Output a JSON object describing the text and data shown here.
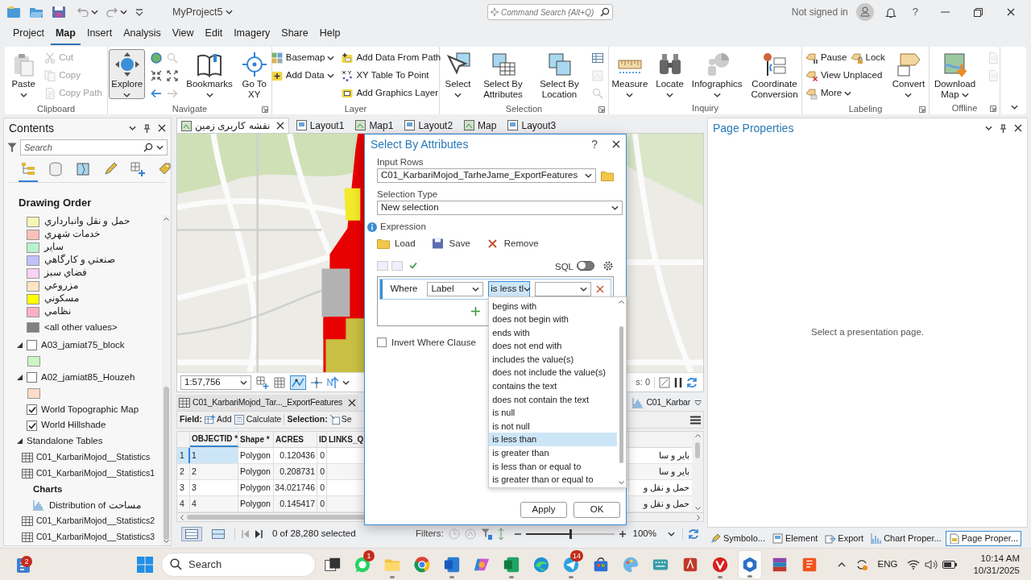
{
  "title_bar": {
    "project": "MyProject5",
    "command_search": {
      "placeholder": "Command Search (Alt+Q)"
    },
    "account": "Not signed in",
    "help": "?"
  },
  "menu_tabs": [
    {
      "label": "Project",
      "selected": false
    },
    {
      "label": "Map",
      "selected": true
    },
    {
      "label": "Insert",
      "selected": false
    },
    {
      "label": "Analysis",
      "selected": false
    },
    {
      "label": "View",
      "selected": false
    },
    {
      "label": "Edit",
      "selected": false
    },
    {
      "label": "Imagery",
      "selected": false
    },
    {
      "label": "Share",
      "selected": false
    },
    {
      "label": "Help",
      "selected": false
    }
  ],
  "ribbon": {
    "groups": [
      {
        "name": "Clipboard",
        "launcher": false,
        "items": [
          {
            "kind": "large",
            "label": "Paste",
            "dropdown": true,
            "disabled": false,
            "selected": false
          },
          {
            "kind": "stack",
            "rows": [
              [
                {
                  "kind": "small",
                  "label": "Cut",
                  "dropdown": false,
                  "disabled": true
                }
              ],
              [
                {
                  "kind": "small",
                  "label": "Copy",
                  "dropdown": false,
                  "disabled": true
                }
              ],
              [
                {
                  "kind": "small",
                  "label": "Copy Path",
                  "dropdown": false,
                  "disabled": true
                }
              ]
            ]
          }
        ]
      },
      {
        "name": "Navigate",
        "launcher": true,
        "items": [
          {
            "kind": "large",
            "label": "Explore",
            "dropdown": true,
            "disabled": false,
            "selected": true
          },
          {
            "kind": "stack",
            "rows": [
              [
                {
                  "kind": "icon",
                  "disabled": false
                },
                {
                  "kind": "icon",
                  "disabled": true
                }
              ],
              [
                {
                  "kind": "icon",
                  "disabled": false
                },
                {
                  "kind": "icon",
                  "disabled": false
                }
              ],
              [
                {
                  "kind": "icon",
                  "disabled": false
                },
                {
                  "kind": "icon",
                  "disabled": true
                }
              ]
            ]
          },
          {
            "kind": "large",
            "label": "Bookmarks",
            "dropdown": true,
            "disabled": false,
            "selected": false
          },
          {
            "kind": "large",
            "label": "Go To XY",
            "dropdown": false,
            "disabled": false,
            "selected": false
          }
        ]
      },
      {
        "name": "Layer",
        "launcher": false,
        "items": [
          {
            "kind": "stack",
            "rows": [
              [
                {
                  "kind": "small",
                  "label": "Basemap",
                  "dropdown": true,
                  "disabled": false
                }
              ],
              [
                {
                  "kind": "small",
                  "label": "Add Data",
                  "dropdown": true,
                  "disabled": false
                }
              ]
            ]
          },
          {
            "kind": "stack",
            "rows": [
              [
                {
                  "kind": "small",
                  "label": "Add Data From Path",
                  "dropdown": false,
                  "disabled": false
                }
              ],
              [
                {
                  "kind": "small",
                  "label": "XY Table To Point",
                  "dropdown": false,
                  "disabled": false
                }
              ],
              [
                {
                  "kind": "small",
                  "label": "Add Graphics Layer",
                  "dropdown": false,
                  "disabled": false
                }
              ]
            ]
          }
        ]
      },
      {
        "name": "Selection",
        "launcher": true,
        "items": [
          {
            "kind": "large",
            "label": "Select",
            "dropdown": true,
            "disabled": false,
            "selected": false
          },
          {
            "kind": "large",
            "label": "Select By Attributes",
            "dropdown": false,
            "disabled": false,
            "selected": false
          },
          {
            "kind": "large",
            "label": "Select By Location",
            "dropdown": false,
            "disabled": false,
            "selected": false
          },
          {
            "kind": "stack",
            "rows": [
              [
                {
                  "kind": "icon",
                  "disabled": false
                }
              ],
              [
                {
                  "kind": "icon",
                  "disabled": true
                }
              ],
              [
                {
                  "kind": "icon",
                  "disabled": true
                }
              ]
            ]
          }
        ]
      },
      {
        "name": "Inquiry",
        "launcher": false,
        "items": [
          {
            "kind": "large",
            "label": "Measure",
            "dropdown": true,
            "disabled": false,
            "selected": false
          },
          {
            "kind": "large",
            "label": "Locate",
            "dropdown": true,
            "disabled": false,
            "selected": false
          },
          {
            "kind": "large",
            "label": "Infographics",
            "dropdown": true,
            "disabled": false,
            "selected": false
          },
          {
            "kind": "large",
            "label": "Coordinate Conversion",
            "dropdown": false,
            "disabled": false,
            "selected": false
          }
        ]
      },
      {
        "name": "Labeling",
        "launcher": true,
        "items": [
          {
            "kind": "stack",
            "rows": [
              [
                {
                  "kind": "small",
                  "label": "Pause",
                  "dropdown": false,
                  "disabled": false
                },
                {
                  "kind": "small",
                  "label": "Lock",
                  "dropdown": false,
                  "disabled": false
                }
              ],
              [
                {
                  "kind": "small",
                  "label": "View Unplaced",
                  "dropdown": false,
                  "disabled": false
                }
              ],
              [
                {
                  "kind": "small",
                  "label": "More",
                  "dropdown": true,
                  "disabled": false
                }
              ]
            ]
          },
          {
            "kind": "large",
            "label": "Convert",
            "dropdown": true,
            "disabled": false,
            "selected": false
          }
        ]
      },
      {
        "name": "Offline",
        "launcher": true,
        "items": [
          {
            "kind": "large",
            "label": "Download Map",
            "dropdown": true,
            "disabled": false,
            "selected": false
          },
          {
            "kind": "stack",
            "rows": [
              [
                {
                  "kind": "icon",
                  "disabled": true
                }
              ],
              [
                {
                  "kind": "icon",
                  "disabled": true
                }
              ]
            ]
          }
        ]
      }
    ]
  },
  "contents": {
    "title": "Contents",
    "search": {
      "placeholder": "Search"
    },
    "views": [
      {
        "selected": true
      },
      {
        "selected": false
      },
      {
        "selected": false
      },
      {
        "selected": false
      },
      {
        "selected": false
      },
      {
        "selected": false
      }
    ],
    "heading": "Drawing Order",
    "legend": [
      {
        "label": "حمل و نقل وانبارداري",
        "color": "#f5f5b4"
      },
      {
        "label": "خدمات شهري",
        "color": "#fcc0b8"
      },
      {
        "label": "ساير",
        "color": "#b8f2cc"
      },
      {
        "label": "صنعتي و كارگاهي",
        "color": "#c0c0fc"
      },
      {
        "label": "فضاي سبز",
        "color": "#fcd2f2"
      },
      {
        "label": "مزروعي",
        "color": "#fce4c4"
      },
      {
        "label": "مسكوني",
        "color": "#ffff00"
      },
      {
        "label": "نظامي",
        "color": "#fcb0c8"
      },
      {
        "label": "<all other values>",
        "color": "#808080"
      }
    ],
    "layers": [
      {
        "name": "A03_jamiat75_block",
        "checked": false,
        "expandable": true,
        "color": "#ccf5c4"
      },
      {
        "name": "A02_jamiat85_Houzeh",
        "checked": false,
        "expandable": true,
        "color": "#fcdcc8"
      },
      {
        "name": "World Topographic Map",
        "checked": true,
        "expandable": false
      },
      {
        "name": "World Hillshade",
        "checked": true,
        "expandable": false
      }
    ],
    "standalone_tables": {
      "title": "Standalone Tables",
      "expanded": true,
      "items": [
        {
          "kind": "table",
          "label": "C01_KarbariMojod__Statistics"
        },
        {
          "kind": "table",
          "label": "C01_KarbariMojod__Statistics1"
        },
        {
          "kind": "group",
          "label": "Charts",
          "children": [
            {
              "kind": "chart",
              "label": "Distribution of مساحت"
            }
          ]
        },
        {
          "kind": "table",
          "label": "C01_KarbariMojod__Statistics2"
        },
        {
          "kind": "table",
          "label": "C01_KarbariMojod__Statistics3"
        }
      ]
    }
  },
  "map_view": {
    "tabs": [
      {
        "label": "نقشه کاربری زمین",
        "kind": "map",
        "selected": true
      },
      {
        "label": "Layout1",
        "kind": "layout",
        "selected": false
      },
      {
        "label": "Map1",
        "kind": "map",
        "selected": false
      },
      {
        "label": "Layout2",
        "kind": "layout",
        "selected": false
      },
      {
        "label": "Map",
        "kind": "map",
        "selected": false
      },
      {
        "label": "Layout3",
        "kind": "layout",
        "selected": false
      }
    ],
    "toolbar": {
      "scale": "1:57,756",
      "status_text": "s: 0"
    }
  },
  "attribute_table": {
    "tabs": [
      {
        "label": "C01_KarbariMojod_Tar..._ExportFeatures",
        "kind": "table",
        "selected": true
      },
      {
        "label": "C01_Karbar",
        "kind": "chart",
        "selected": false
      }
    ],
    "toolbar": {
      "field_label": "Field:",
      "field_buttons": [
        "Add",
        "Calculate"
      ],
      "selection_label": "Selection:",
      "selection_buttons": [
        "Se"
      ]
    },
    "columns": [
      "OBJECTID *",
      "Shape *",
      "ACRES",
      "ID",
      "LINKS_Q"
    ],
    "rows": [
      {
        "number": "1",
        "cells": [
          "1",
          "Polygon",
          "0.120436",
          "0"
        ],
        "column_7": "باير و سا",
        "active": true
      },
      {
        "number": "2",
        "cells": [
          "2",
          "Polygon",
          "0.208731",
          "0"
        ],
        "column_7": "باير و سا",
        "active": false
      },
      {
        "number": "3",
        "cells": [
          "3",
          "Polygon",
          "34.021746",
          "0"
        ],
        "column_7": "حمل و نقل و",
        "active": false
      },
      {
        "number": "4",
        "cells": [
          "4",
          "Polygon",
          "0.145417",
          "0"
        ],
        "column_7": "حمل و نقل و",
        "active": false
      }
    ],
    "status": {
      "selection": "0 of 28,280 selected",
      "filters_label": "Filters:",
      "zoom": {
        "level": 0.5
      },
      "zoom_value": "100%"
    }
  },
  "page_properties": {
    "title": "Page Properties",
    "message": "Select a presentation page."
  },
  "dock_tabs": [
    {
      "label": "Symbolo...",
      "selected": false
    },
    {
      "label": "Element",
      "selected": false
    },
    {
      "label": "Export",
      "selected": false
    },
    {
      "label": "Chart Proper...",
      "selected": false
    },
    {
      "label": "Page Proper...",
      "selected": true
    }
  ],
  "dialog": {
    "title": "Select By Attributes",
    "help": "?",
    "input_rows": {
      "label": "Input Rows",
      "value": "C01_KarbariMojod_TarheJame_ExportFeatures"
    },
    "selection_type": {
      "label": "Selection Type",
      "value": "New selection"
    },
    "expression": {
      "label": "Expression",
      "actions": [
        "Load",
        "Save",
        "Remove"
      ],
      "sql_label": "SQL",
      "sql": false,
      "clause": {
        "where": "Where",
        "field": "Label",
        "operator": "is less tl",
        "operator_open": true
      },
      "options": [
        {
          "label": "begins with",
          "selected": false
        },
        {
          "label": "does not begin with",
          "selected": false
        },
        {
          "label": "ends with",
          "selected": false
        },
        {
          "label": "does not end with",
          "selected": false
        },
        {
          "label": "includes the value(s)",
          "selected": false
        },
        {
          "label": "does not include the value(s)",
          "selected": false
        },
        {
          "label": "contains the text",
          "selected": false
        },
        {
          "label": "does not contain the text",
          "selected": false
        },
        {
          "label": "is null",
          "selected": false
        },
        {
          "label": "is not null",
          "selected": false
        },
        {
          "label": "is less than",
          "selected": true
        },
        {
          "label": "is greater than",
          "selected": false
        },
        {
          "label": "is less than or equal to",
          "selected": false
        },
        {
          "label": "is greater than or equal to",
          "selected": false
        }
      ]
    },
    "invert": {
      "label": "Invert Where Clause",
      "checked": false
    },
    "buttons": [
      "Apply",
      "OK"
    ]
  },
  "taskbar": {
    "widgets": {
      "badge": "2"
    },
    "search": {
      "placeholder": "Search"
    },
    "apps": [
      {
        "running": false,
        "selected": false
      },
      {
        "running": false,
        "selected": false,
        "badge": "1"
      },
      {
        "running": true,
        "selected": false
      },
      {
        "running": false,
        "selected": false
      },
      {
        "running": true,
        "selected": false
      },
      {
        "running": false,
        "selected": false
      },
      {
        "running": true,
        "selected": false
      },
      {
        "running": false,
        "selected": false
      },
      {
        "running": true,
        "selected": false,
        "badge": "14"
      },
      {
        "running": false,
        "selected": false
      },
      {
        "running": false,
        "selected": false
      },
      {
        "running": false,
        "selected": false
      },
      {
        "running": false,
        "selected": false
      },
      {
        "running": true,
        "selected": false
      },
      {
        "running": true,
        "selected": true
      },
      {
        "running": false,
        "selected": false
      },
      {
        "running": false,
        "selected": false
      }
    ],
    "language": "ENG",
    "time": "10:14 AM",
    "date": "10/31/2025"
  }
}
